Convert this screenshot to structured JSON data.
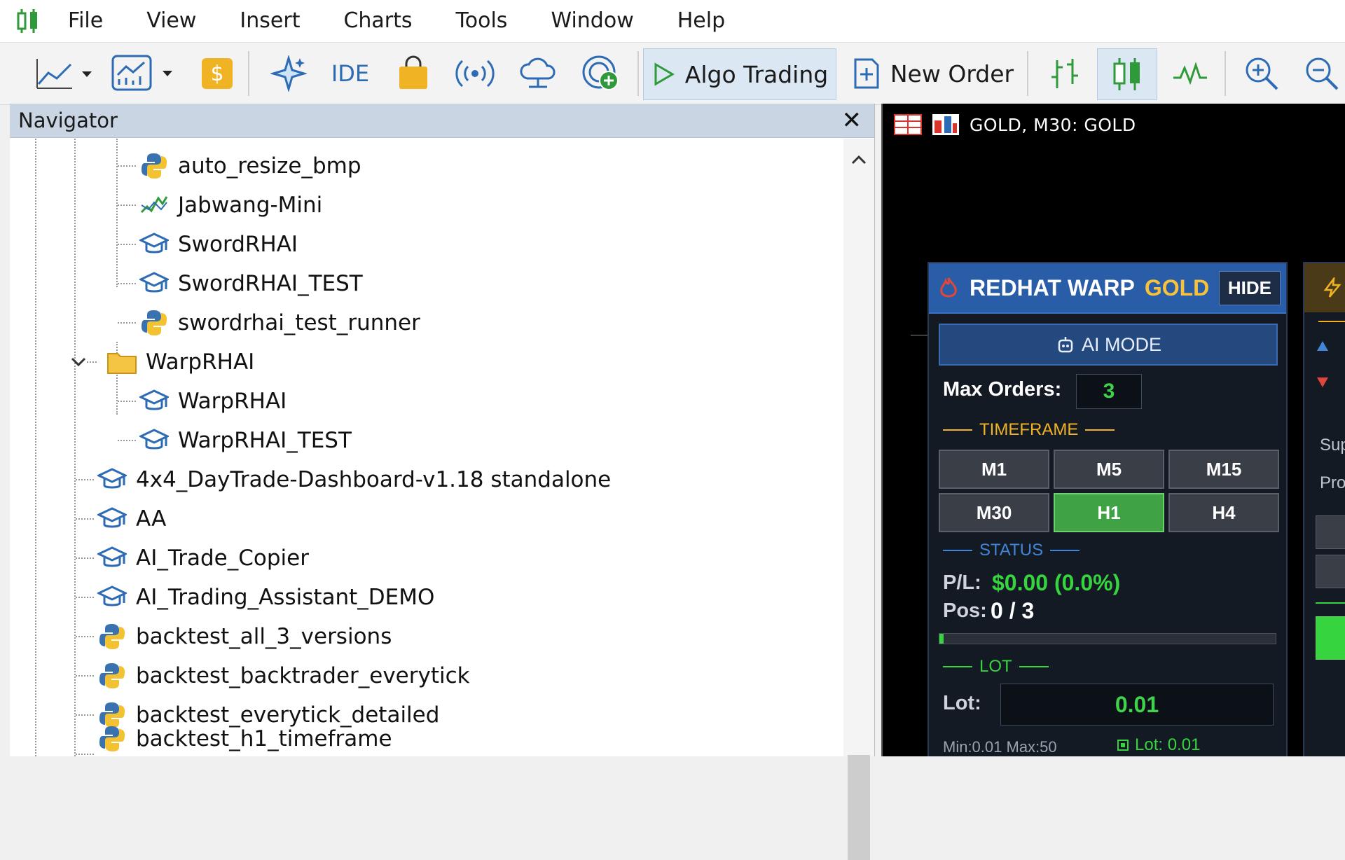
{
  "menubar": {
    "items": [
      "File",
      "View",
      "Insert",
      "Charts",
      "Tools",
      "Window",
      "Help"
    ]
  },
  "toolbar": {
    "ide_label": "IDE",
    "algo_trading_label": "Algo Trading",
    "new_order_label": "New Order"
  },
  "navigator": {
    "title": "Navigator",
    "close_symbol": "✕",
    "items": [
      {
        "label": "auto_resize_bmp",
        "icon": "python-icon"
      },
      {
        "label": "Jabwang-Mini",
        "icon": "indicator-icon"
      },
      {
        "label": "SwordRHAI",
        "icon": "expert-advisor-icon"
      },
      {
        "label": "SwordRHAI_TEST",
        "icon": "expert-advisor-icon"
      },
      {
        "label": "swordrhai_test_runner",
        "icon": "python-icon"
      },
      {
        "label": "WarpRHAI",
        "icon": "folder-icon"
      },
      {
        "label": "WarpRHAI",
        "icon": "expert-advisor-icon"
      },
      {
        "label": "WarpRHAI_TEST",
        "icon": "expert-advisor-icon"
      },
      {
        "label": "4x4_DayTrade-Dashboard-v1.18 standalone",
        "icon": "expert-advisor-icon"
      },
      {
        "label": "AA",
        "icon": "expert-advisor-icon"
      },
      {
        "label": "AI_Trade_Copier",
        "icon": "expert-advisor-icon"
      },
      {
        "label": "AI_Trading_Assistant_DEMO",
        "icon": "expert-advisor-icon"
      },
      {
        "label": "backtest_all_3_versions",
        "icon": "python-icon"
      },
      {
        "label": "backtest_backtrader_everytick",
        "icon": "python-icon"
      },
      {
        "label": "backtest_everytick_detailed",
        "icon": "python-icon"
      },
      {
        "label": "backtest_h1_timeframe",
        "icon": "python-icon"
      }
    ]
  },
  "chart": {
    "title": "GOLD, M30:  GOLD"
  },
  "ea_panel": {
    "brand": "REDHAT WARP",
    "symbol": "GOLD",
    "hide_label": "HIDE",
    "ai_mode_label": "AI MODE",
    "max_orders_label": "Max Orders:",
    "max_orders_value": "3",
    "timeframe_title": "TIMEFRAME",
    "timeframes": [
      "M1",
      "M5",
      "M15",
      "M30",
      "H1",
      "H4"
    ],
    "active_timeframe": "H1",
    "status_title": "STATUS",
    "pl_label": "P/L:",
    "pl_value": "$0.00 (0.0%)",
    "pos_label": "Pos:",
    "pos_value": "0 / 3",
    "progress_fraction": 0.0,
    "lot_title": "LOT",
    "lot_label": "Lot:",
    "lot_value": "0.01",
    "min_max": "Min:0.01 Max:50",
    "lot_echo": "Lot: 0.01"
  },
  "panel2": {
    "sup_text": "Sup",
    "pro_text": "Pro"
  },
  "colors": {
    "panel_header": "#2a5da8",
    "gold": "#f6c23e",
    "green": "#36d43e",
    "navigator_header": "#c9d5e3"
  }
}
